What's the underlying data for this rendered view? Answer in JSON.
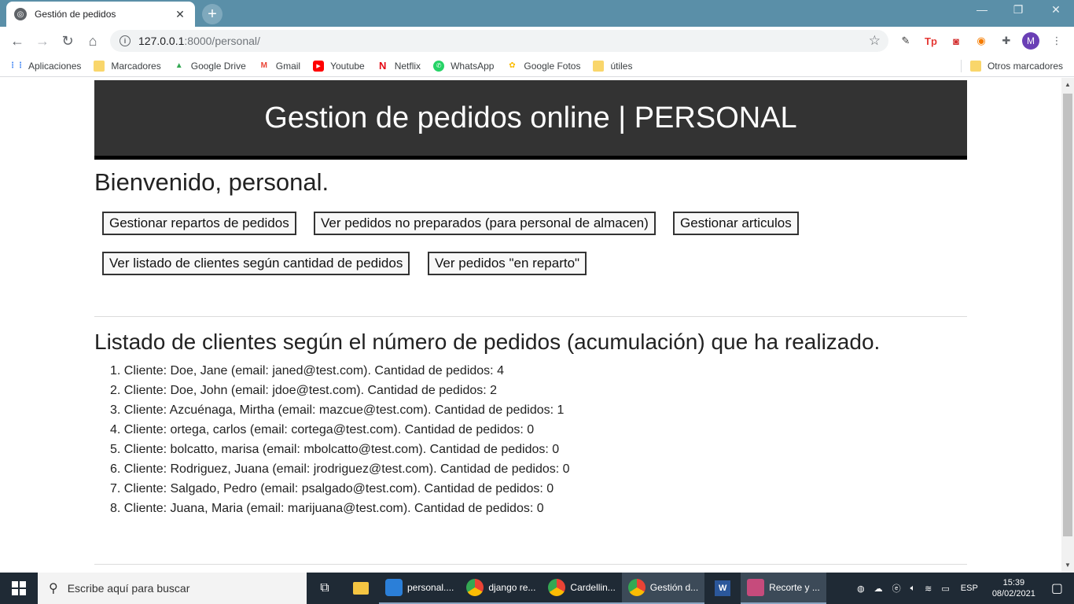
{
  "browser": {
    "tab_title": "Gestión de pedidos",
    "url_host": "127.0.0.1",
    "url_path": ":8000/personal/"
  },
  "bookmarks": {
    "items": [
      {
        "label": "Aplicaciones",
        "icon": "apps-grid-icon"
      },
      {
        "label": "Marcadores",
        "icon": "folder-icon"
      },
      {
        "label": "Google Drive",
        "icon": "drive-icon"
      },
      {
        "label": "Gmail",
        "icon": "gmail-icon"
      },
      {
        "label": "Youtube",
        "icon": "youtube-icon"
      },
      {
        "label": "Netflix",
        "icon": "netflix-icon"
      },
      {
        "label": "WhatsApp",
        "icon": "whatsapp-icon"
      },
      {
        "label": "Google Fotos",
        "icon": "photos-icon"
      },
      {
        "label": "útiles",
        "icon": "folder-icon"
      }
    ],
    "other": "Otros marcadores"
  },
  "page": {
    "header_title": "Gestion de pedidos online | PERSONAL",
    "welcome": "Bienvenido, personal.",
    "buttons": {
      "repartos": "Gestionar repartos de pedidos",
      "no_preparados": "Ver pedidos no preparados (para personal de almacen)",
      "articulos": "Gestionar articulos",
      "listado_clientes": "Ver listado de clientes según cantidad de pedidos",
      "en_reparto": "Ver pedidos \"en reparto\""
    },
    "list_title": "Listado de clientes según el número de pedidos (acumulación) que ha realizado.",
    "clients": [
      "1. Cliente: Doe, Jane (email: janed@test.com). Cantidad de pedidos: 4",
      "2. Cliente: Doe, John (email: jdoe@test.com). Cantidad de pedidos: 2",
      "3. Cliente: Azcuénaga, Mirtha (email: mazcue@test.com). Cantidad de pedidos: 1",
      "4. Cliente: ortega, carlos (email: cortega@test.com). Cantidad de pedidos: 0",
      "5. Cliente: bolcatto, marisa (email: mbolcatto@test.com). Cantidad de pedidos: 0",
      "6. Cliente: Rodriguez, Juana (email: jrodriguez@test.com). Cantidad de pedidos: 0",
      "7. Cliente: Salgado, Pedro (email: psalgado@test.com). Cantidad de pedidos: 0",
      "8. Cliente: Juana, Maria (email: marijuana@test.com). Cantidad de pedidos: 0"
    ]
  },
  "taskbar": {
    "search_placeholder": "Escribe aquí para buscar",
    "apps": [
      {
        "label": "personal....",
        "color": "#2b7fd8"
      },
      {
        "label": "django re...",
        "color": "#e8453c"
      },
      {
        "label": "Cardellin...",
        "color": "#e8453c"
      },
      {
        "label": "Gestión d...",
        "color": "#e8453c"
      },
      {
        "label": "Recorte y ...",
        "color": "#c64b7c"
      }
    ],
    "language": "ESP",
    "time": "15:39",
    "date": "08/02/2021"
  },
  "profile_initial": "M"
}
